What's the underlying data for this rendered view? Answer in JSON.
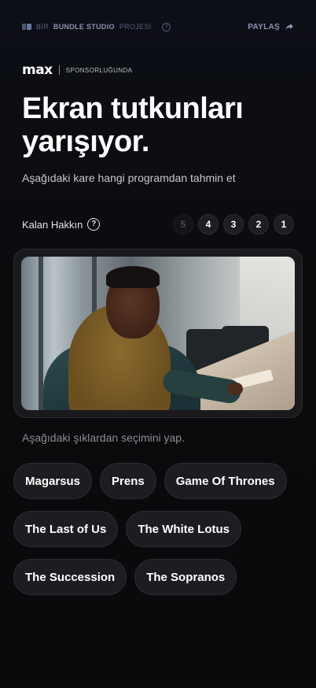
{
  "topbar": {
    "studio_prefix": "BİR",
    "studio_name": "BUNDLE STUDIO",
    "studio_suffix": "PROJESİ",
    "help_glyph": "?",
    "share_label": "PAYLAŞ",
    "share_icon": "share-arrow-icon"
  },
  "sponsor": {
    "logo": "max",
    "text": "SPONSORLUĞUNDA"
  },
  "headline": "Ekran tutkunları yarışıyor.",
  "subtitle": "Aşağıdaki kare hangi programdan tahmin et",
  "lives": {
    "label": "Kalan Hakkın",
    "help_glyph": "?",
    "counts": [
      {
        "value": "5",
        "used": true
      },
      {
        "value": "4",
        "used": false
      },
      {
        "value": "3",
        "used": false
      },
      {
        "value": "2",
        "used": false
      },
      {
        "value": "1",
        "used": false
      }
    ]
  },
  "frame_image": "tv-still-boy-at-table",
  "choose_label": "Aşağıdaki şıklardan seçimini yap.",
  "options": [
    "Magarsus",
    "Prens",
    "Game Of Thrones",
    "The Last of Us",
    "The White Lotus",
    "The Succession",
    "The Sopranos"
  ],
  "colors": {
    "background": "#0b0b0e",
    "chip": "#1d1d21",
    "muted": "#8d8d92",
    "accent": "#8a94b0"
  }
}
